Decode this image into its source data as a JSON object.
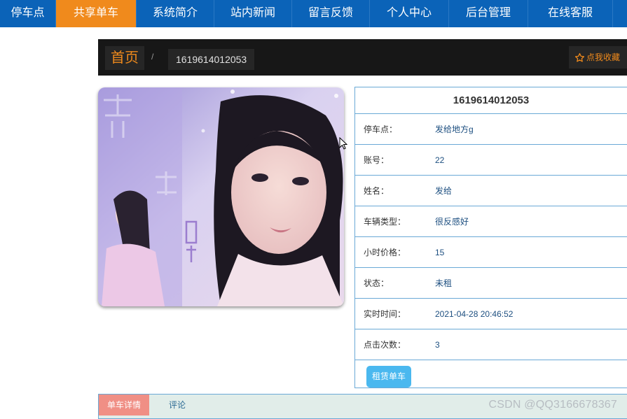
{
  "nav": {
    "items": [
      {
        "label": "停车点",
        "width": 80
      },
      {
        "label": "共享单车",
        "width": 115,
        "active": true
      },
      {
        "label": "系统简介",
        "width": 111
      },
      {
        "label": "站内新闻",
        "width": 111
      },
      {
        "label": "留言反馈",
        "width": 111
      },
      {
        "label": "个人中心",
        "width": 113
      },
      {
        "label": "后台管理",
        "width": 113
      },
      {
        "label": "在线客服",
        "width": 111
      }
    ],
    "colors": {
      "bar": "#0b63b8",
      "active": "#f08a1c"
    }
  },
  "breadcrumb": {
    "home": "首页",
    "separator": "/",
    "current": "1619614012053",
    "favorite_label": "点我收藏",
    "favorite_icon": "star-outline-icon"
  },
  "detail": {
    "title": "1619614012053",
    "rows": [
      {
        "label": "停车点：",
        "value": "发给地方g"
      },
      {
        "label": "账号：",
        "value": "22"
      },
      {
        "label": "姓名：",
        "value": "发给"
      },
      {
        "label": "车辆类型：",
        "value": "很反感好"
      },
      {
        "label": "小时价格：",
        "value": "15"
      },
      {
        "label": "状态：",
        "value": "未租"
      },
      {
        "label": "实时时间：",
        "value": "2021-04-28 20:46:52"
      },
      {
        "label": "点击次数：",
        "value": "3"
      }
    ],
    "rent_button": "租赁单车"
  },
  "tabs": {
    "details": "单车详情",
    "comments": "评论"
  },
  "watermark": "CSDN @QQ3166678367"
}
